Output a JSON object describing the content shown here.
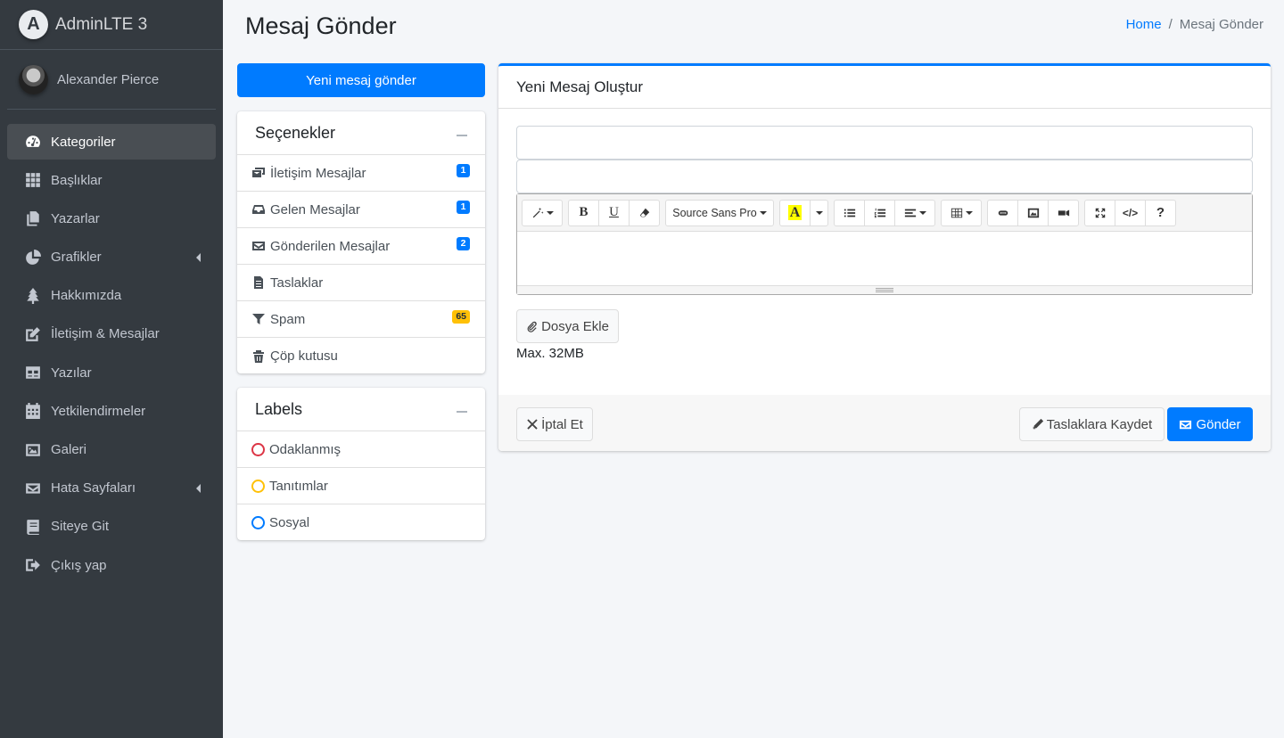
{
  "brand": {
    "name": "AdminLTE 3",
    "logo_letter": "A"
  },
  "user": {
    "name": "Alexander Pierce"
  },
  "sidebar": {
    "items": [
      {
        "label": "Kategoriler",
        "icon": "tachometer-icon"
      },
      {
        "label": "Başlıklar",
        "icon": "grid-icon"
      },
      {
        "label": "Yazarlar",
        "icon": "copy-icon"
      },
      {
        "label": "Grafikler",
        "icon": "pie-chart-icon"
      },
      {
        "label": "Hakkımızda",
        "icon": "tree-icon"
      },
      {
        "label": "İletişim & Mesajlar",
        "icon": "edit-icon"
      },
      {
        "label": "Yazılar",
        "icon": "table-icon"
      },
      {
        "label": "Yetkilendirmeler",
        "icon": "calendar-icon"
      },
      {
        "label": "Galeri",
        "icon": "image-icon"
      },
      {
        "label": "Hata Sayfaları",
        "icon": "envelope-icon"
      },
      {
        "label": "Siteye Git",
        "icon": "book-icon"
      },
      {
        "label": "Çıkış yap",
        "icon": "sign-out-icon"
      }
    ],
    "active_index": 0
  },
  "header": {
    "title": "Mesaj Gönder",
    "breadcrumb_home": "Home",
    "breadcrumb_separator": "/",
    "breadcrumb_current": "Mesaj Gönder"
  },
  "compose_button": "Yeni mesaj gönder",
  "folders": {
    "title": "Seçenekler",
    "items": [
      {
        "label": "İletişim Mesajlar",
        "badge": "1"
      },
      {
        "label": "Gelen Mesajlar",
        "badge": "1"
      },
      {
        "label": "Gönderilen Mesajlar",
        "badge": "2"
      },
      {
        "label": "Taslaklar"
      },
      {
        "label": "Spam",
        "badge": "65"
      },
      {
        "label": "Çöp kutusu"
      }
    ]
  },
  "labels": {
    "title": "Labels",
    "items": [
      {
        "label": "Odaklanmış",
        "color": "#dc3545"
      },
      {
        "label": "Tanıtımlar",
        "color": "#ffc107"
      },
      {
        "label": "Sosyal",
        "color": "#007bff"
      }
    ]
  },
  "compose": {
    "title": "Yeni Mesaj Oluştur",
    "to_value": "",
    "subject_value": "",
    "font_name": "Source Sans Pro",
    "attach_label": "Dosya Ekle",
    "max_size": "Max. 32MB",
    "cancel_label": "İptal Et",
    "draft_label": "Taslaklara Kaydet",
    "send_label": "Gönder"
  },
  "colors": {
    "primary": "#007bff",
    "sidebar_bg": "#343a40",
    "warning": "#ffc107",
    "danger": "#dc3545"
  }
}
